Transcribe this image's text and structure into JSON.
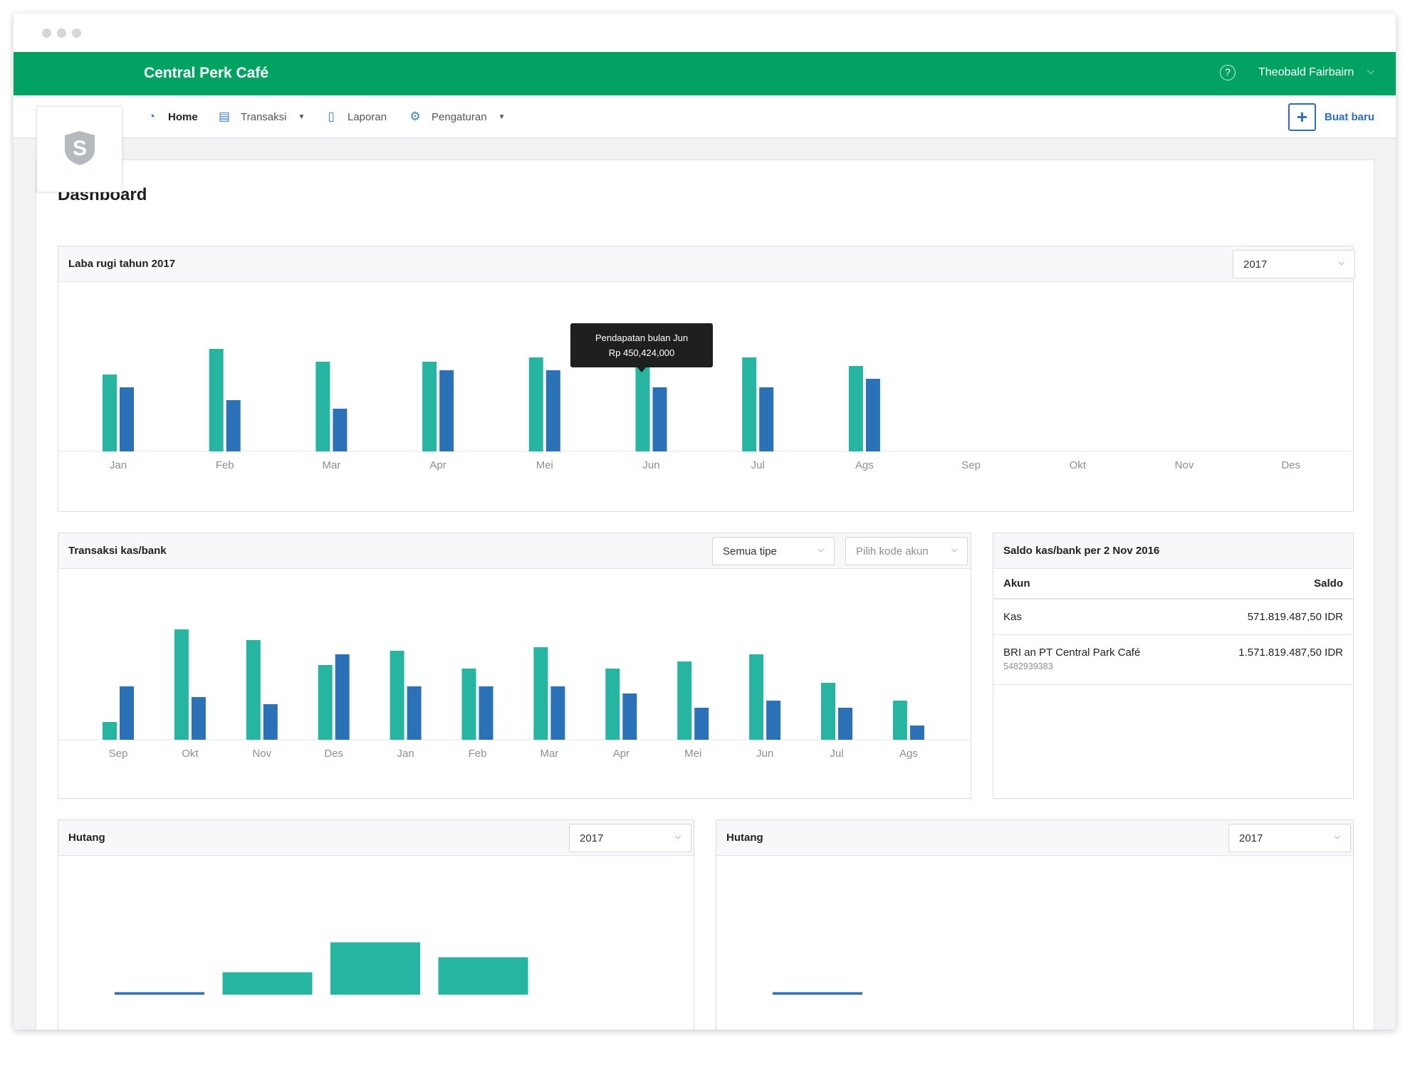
{
  "app": {
    "title": "Central Perk Café",
    "user_name": "Theobald Fairbairn",
    "help_icon": "help-circle-icon",
    "logo_letter": "S"
  },
  "nav": {
    "items": [
      {
        "label": "Home",
        "icon": "dashboard-icon"
      },
      {
        "label": "Transaksi",
        "icon": "money-icon"
      },
      {
        "label": "Laporan",
        "icon": "document-icon"
      },
      {
        "label": "Pengaturan",
        "icon": "gear-icon"
      }
    ],
    "new_button": "Buat baru"
  },
  "page": {
    "title": "Dashboard"
  },
  "colors": {
    "brand": "#02a262",
    "teal": "#26b5a0",
    "blue": "#2b71b8",
    "link": "#2a6dc4"
  },
  "laba_rugi": {
    "title": "Laba rugi tahun 2017",
    "year_select": "2017",
    "tooltip": {
      "line1": "Pendapatan bulan Jun",
      "line2": "Rp 450,424,000"
    }
  },
  "transaksi": {
    "title": "Transaksi kas/bank",
    "type_select": "Semua tipe",
    "account_placeholder": "Pilih kode akun"
  },
  "saldo": {
    "title": "Saldo kas/bank per 2 Nov 2016",
    "col_account": "Akun",
    "col_balance": "Saldo",
    "rows": [
      {
        "account": "Kas",
        "sub": "",
        "balance": "571.819.487,50 IDR"
      },
      {
        "account": "BRI an PT Central Park Café",
        "sub": "5482939383",
        "balance": "1.571.819.487,50 IDR"
      }
    ]
  },
  "hutang_left": {
    "title": "Hutang",
    "year_select": "2017"
  },
  "hutang_right": {
    "title": "Hutang",
    "year_select": "2017"
  },
  "chart_data": [
    {
      "type": "bar",
      "title": "Laba rugi tahun 2017",
      "categories": [
        "Jan",
        "Feb",
        "Mar",
        "Apr",
        "Mei",
        "Jun",
        "Jul",
        "Ags",
        "Sep",
        "Okt",
        "Nov",
        "Des"
      ],
      "series": [
        {
          "values": [
            18,
            24,
            21,
            21,
            22,
            20,
            22,
            20,
            null,
            null,
            null,
            null
          ]
        },
        {
          "values": [
            15,
            12,
            10,
            19,
            19,
            15,
            15,
            17,
            null,
            null,
            null,
            null
          ]
        }
      ],
      "ylim": [
        0,
        40
      ],
      "grid": false
    },
    {
      "type": "bar",
      "title": "Transaksi kas/bank",
      "categories": [
        "Sep",
        "Okt",
        "Nov",
        "Des",
        "Jan",
        "Feb",
        "Mar",
        "Apr",
        "Mei",
        "Jun",
        "Jul",
        "Ags"
      ],
      "series": [
        {
          "values": [
            5,
            31,
            28,
            21,
            25,
            20,
            26,
            20,
            22,
            24,
            16,
            11
          ]
        },
        {
          "values": [
            15,
            12,
            10,
            24,
            15,
            15,
            15,
            13,
            9,
            11,
            9,
            4
          ]
        }
      ],
      "ylim": [
        0,
        40
      ],
      "grid": false
    },
    {
      "type": "bar",
      "title": "Hutang",
      "series": [
        {
          "values": [
            1,
            9,
            21,
            15
          ]
        }
      ],
      "ylim": [
        0,
        30
      ]
    },
    {
      "type": "bar",
      "title": "Hutang",
      "series": [
        {
          "values": [
            1
          ]
        }
      ],
      "ylim": [
        0,
        30
      ]
    }
  ]
}
